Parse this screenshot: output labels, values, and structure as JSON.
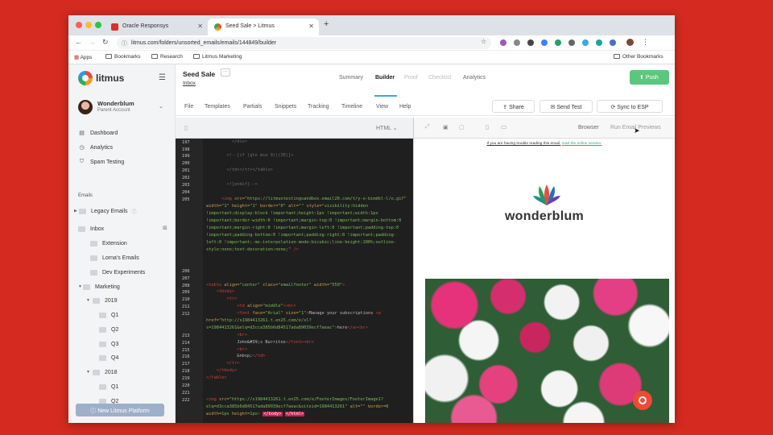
{
  "browser": {
    "tabs": [
      {
        "title": "Oracle Responsys",
        "active": false
      },
      {
        "title": "Seed Sale > Litmus",
        "active": true
      }
    ],
    "url": "litmus.com/folders/unsorted_emails/emails/144849/builder",
    "bookmarks": [
      "Apps",
      "Bookmarks",
      "Research",
      "Litmus Marketing"
    ],
    "other_bookmarks": "Other Bookmarks"
  },
  "sidebar": {
    "brand": "litmus",
    "account_name": "Wonderblum",
    "account_sub": "Parent Account",
    "nav": [
      "Dashboard",
      "Analytics",
      "Spam Testing"
    ],
    "emails_heading": "Emails",
    "legacy": "Legacy Emails",
    "inbox": "Inbox",
    "inbox_children": [
      "Extension",
      "Lorna's Emails",
      "Dev Experiments"
    ],
    "marketing": "Marketing",
    "year_2019": "2019",
    "q2019": [
      "Q1",
      "Q2",
      "Q3",
      "Q4"
    ],
    "year_2018": "2018",
    "q2018": [
      "Q1",
      "Q2"
    ],
    "new_platform_button": "New Litmus Platform"
  },
  "header": {
    "title": "Seed Sale",
    "more": "···",
    "folder": "Inbox",
    "tabs": [
      "Summary",
      "Builder",
      "Proof",
      "Checklist",
      "Analytics"
    ],
    "push": "Push"
  },
  "toolbar": {
    "menus": [
      "File",
      "Templates",
      "Partials",
      "Snippets",
      "Tracking",
      "Timeline",
      "View",
      "Help"
    ],
    "share": "Share",
    "send_test": "Send Test",
    "sync": "Sync to ESP"
  },
  "editor": {
    "mode": "HTML",
    "line_numbers": [
      "197",
      "198",
      "199",
      "200",
      "201",
      "202",
      "203",
      "204",
      "205",
      "206",
      "207",
      "208",
      "209",
      "210",
      "211",
      "212",
      "213",
      "214",
      "215",
      "216",
      "217",
      "218",
      "219",
      "220",
      "221",
      "222"
    ]
  },
  "preview": {
    "browser_label": "Browser",
    "run_previews": "Run Email Previews",
    "trouble_text": "If you are having trouble reading this email,",
    "trouble_link": "read the online version.",
    "brand_name": "wonderblum"
  },
  "colors": {
    "background": "#d42a1f",
    "push_green": "#5bc77d",
    "accent_blue": "#3aa7e0",
    "code_bg": "#1f1f1f"
  }
}
